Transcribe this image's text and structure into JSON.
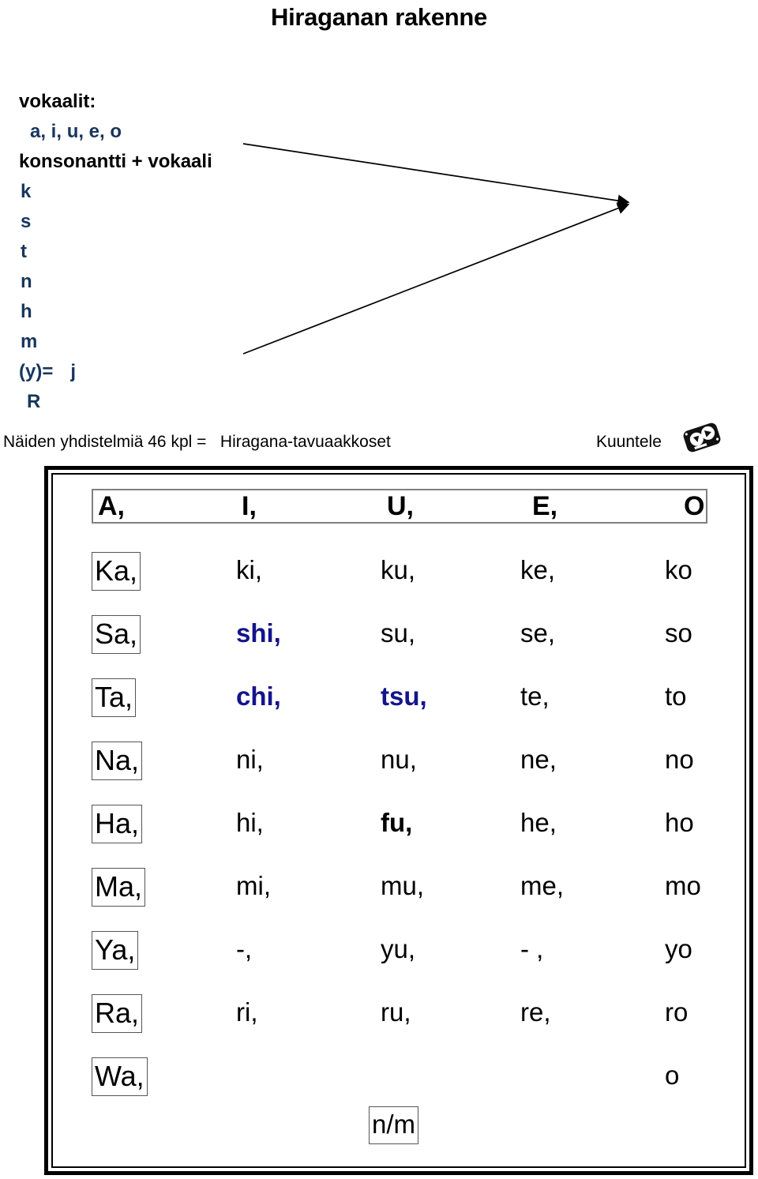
{
  "title": "Hiraganan rakenne",
  "explainer": {
    "vowels_label": "vokaalit:",
    "vowels_list": "a, i, u, e, o",
    "combo_label": "konsonantti + vokaali",
    "consonants": [
      "k",
      "s",
      "t",
      "n",
      "h",
      "m"
    ],
    "y_line_left": "(y)=",
    "y_line_right": "j",
    "r_line": "R"
  },
  "caption": {
    "left_text": "Näiden yhdistelmiä 46 kpl =   Hiragana-tavuaakkoset",
    "listen_label": "Kuuntele",
    "audio_icon": "cassette-audio-icon"
  },
  "table": {
    "header": [
      "A,",
      "I,",
      "U,",
      "E,",
      "O"
    ],
    "rows": [
      {
        "head": "Ka,",
        "cells": [
          {
            "text": "ki,",
            "style": "plain"
          },
          {
            "text": "ku,",
            "style": "plain"
          },
          {
            "text": "ke,",
            "style": "plain"
          },
          {
            "text": "ko",
            "style": "plain"
          }
        ]
      },
      {
        "head": "Sa,",
        "cells": [
          {
            "text": "shi,",
            "style": "blue-bold"
          },
          {
            "text": "su,",
            "style": "plain"
          },
          {
            "text": "se,",
            "style": "plain"
          },
          {
            "text": "so",
            "style": "plain"
          }
        ]
      },
      {
        "head": "Ta,",
        "cells": [
          {
            "text": "chi,",
            "style": "blue-bold"
          },
          {
            "text": "tsu,",
            "style": "blue-bold"
          },
          {
            "text": "te,",
            "style": "plain"
          },
          {
            "text": "to",
            "style": "plain"
          }
        ]
      },
      {
        "head": "Na,",
        "cells": [
          {
            "text": "ni,",
            "style": "plain"
          },
          {
            "text": "nu,",
            "style": "plain"
          },
          {
            "text": "ne,",
            "style": "plain"
          },
          {
            "text": "no",
            "style": "plain"
          }
        ]
      },
      {
        "head": "Ha,",
        "cells": [
          {
            "text": "hi,",
            "style": "plain"
          },
          {
            "text": "fu,",
            "style": "black-bold"
          },
          {
            "text": "he,",
            "style": "plain"
          },
          {
            "text": "ho",
            "style": "plain"
          }
        ]
      },
      {
        "head": "Ma,",
        "cells": [
          {
            "text": "mi,",
            "style": "plain"
          },
          {
            "text": "mu,",
            "style": "plain"
          },
          {
            "text": "me,",
            "style": "plain"
          },
          {
            "text": "mo",
            "style": "plain"
          }
        ]
      },
      {
        "head": "Ya,",
        "cells": [
          {
            "text": "-,",
            "style": "plain"
          },
          {
            "text": "yu,",
            "style": "plain"
          },
          {
            "text": "- ,",
            "style": "plain"
          },
          {
            "text": "yo",
            "style": "plain"
          }
        ]
      },
      {
        "head": "Ra,",
        "cells": [
          {
            "text": "ri,",
            "style": "plain"
          },
          {
            "text": "ru,",
            "style": "plain"
          },
          {
            "text": "re,",
            "style": "plain"
          },
          {
            "text": "ro",
            "style": "plain"
          }
        ]
      },
      {
        "head": "Wa,",
        "cells": [
          {
            "text": "",
            "style": "plain"
          },
          {
            "text": "",
            "style": "plain"
          },
          {
            "text": "",
            "style": "plain"
          },
          {
            "text": "o",
            "style": "plain"
          }
        ]
      }
    ],
    "final_cell": "n/m"
  },
  "colors": {
    "blue_explainer": "#17365D",
    "blue_table": "#14148C",
    "black": "#000000"
  }
}
